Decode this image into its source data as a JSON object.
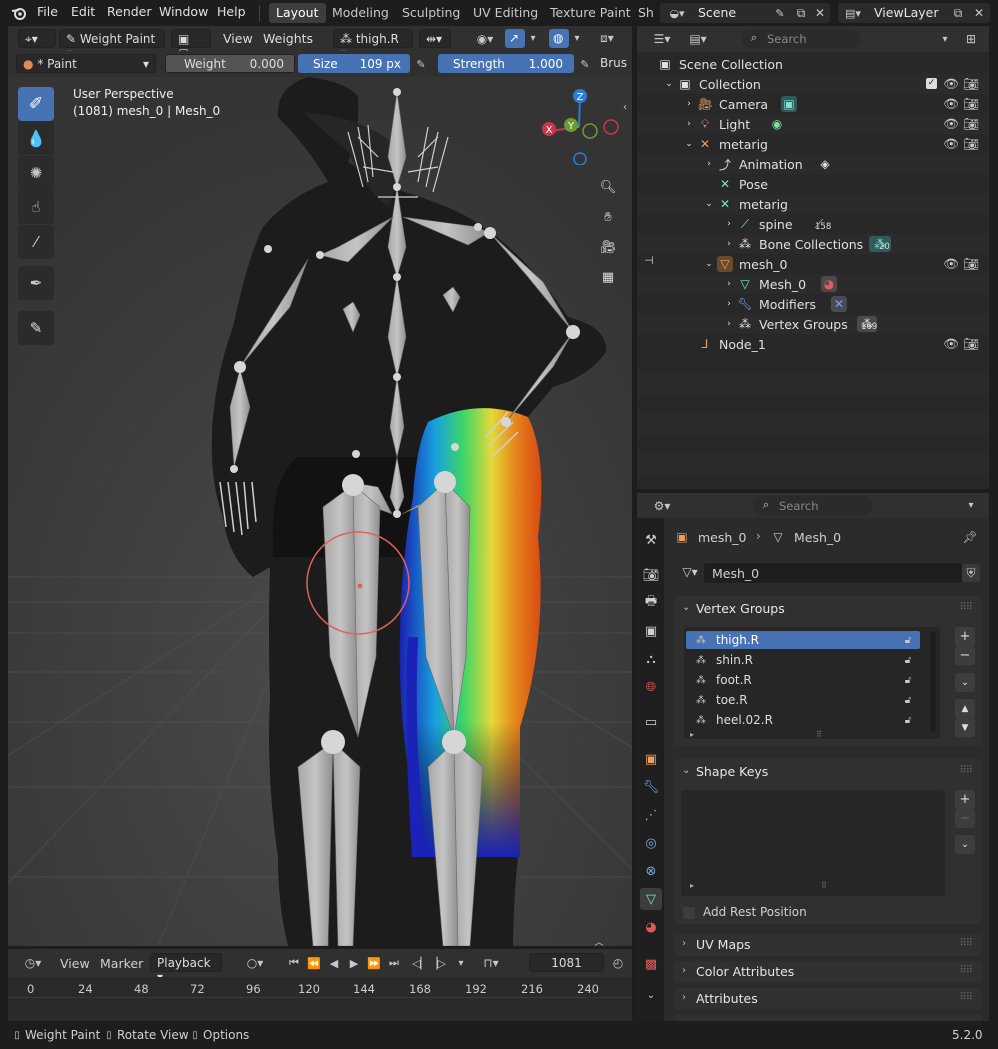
{
  "menu": {
    "file": "File",
    "edit": "Edit",
    "render": "Render",
    "window": "Window",
    "help": "Help"
  },
  "workspaces": [
    "Layout",
    "Modeling",
    "Sculpting",
    "UV Editing",
    "Texture Paint",
    "Sh"
  ],
  "scene": {
    "name": "Scene",
    "view_layer": "ViewLayer"
  },
  "viewport": {
    "mode": "Weight Paint",
    "view_menu": "View",
    "weights_menu": "Weights",
    "vertex_group": "thigh.R",
    "brush": "* Paint",
    "weight_label": "Weight",
    "weight_value": "0.000",
    "size_label": "Size",
    "size_value": "109 px",
    "strength_label": "Strength",
    "strength_value": "1.000",
    "brush_label": "Brus",
    "perspective": "User Perspective",
    "object_info": "(1081) mesh_0 | Mesh_0",
    "gizmo": {
      "z": "Z",
      "x": "X",
      "y": "Y"
    }
  },
  "timeline": {
    "view": "View",
    "marker": "Marker",
    "playback": "Playback",
    "frame": "1081",
    "ticks": [
      "0",
      "24",
      "48",
      "72",
      "96",
      "120",
      "144",
      "168",
      "192",
      "216",
      "240"
    ]
  },
  "status": {
    "item1": "Weight Paint",
    "item2": "Rotate View",
    "item3": "Options",
    "version": "5.2.0"
  },
  "outliner": {
    "search_placeholder": "Search",
    "rows": [
      {
        "label": "Scene Collection"
      },
      {
        "label": "Collection"
      },
      {
        "label": "Camera"
      },
      {
        "label": "Light"
      },
      {
        "label": "metarig"
      },
      {
        "label": "Animation"
      },
      {
        "label": "Pose"
      },
      {
        "label": "metarig"
      },
      {
        "label": "spine",
        "badge": "158"
      },
      {
        "label": "Bone Collections",
        "badge": "20"
      },
      {
        "label": "mesh_0"
      },
      {
        "label": "Mesh_0"
      },
      {
        "label": "Modifiers"
      },
      {
        "label": "Vertex Groups",
        "badge": "169"
      },
      {
        "label": "Node_1"
      }
    ]
  },
  "properties": {
    "search_placeholder": "Search",
    "breadcrumb_object": "mesh_0",
    "breadcrumb_data": "Mesh_0",
    "mesh_name": "Mesh_0",
    "vertex_groups_title": "Vertex Groups",
    "vertex_groups": [
      "thigh.R",
      "shin.R",
      "foot.R",
      "toe.R",
      "heel.02.R"
    ],
    "shape_keys_title": "Shape Keys",
    "add_rest_position": "Add Rest Position",
    "uv_maps": "UV Maps",
    "color_attributes": "Color Attributes",
    "attributes": "Attributes"
  },
  "colors": {
    "accent": "#4772b3",
    "x_axis": "#c9374b",
    "y_axis": "#6a9c2e",
    "z_axis": "#2e7bd6",
    "brush_circle": "#e0605a"
  }
}
